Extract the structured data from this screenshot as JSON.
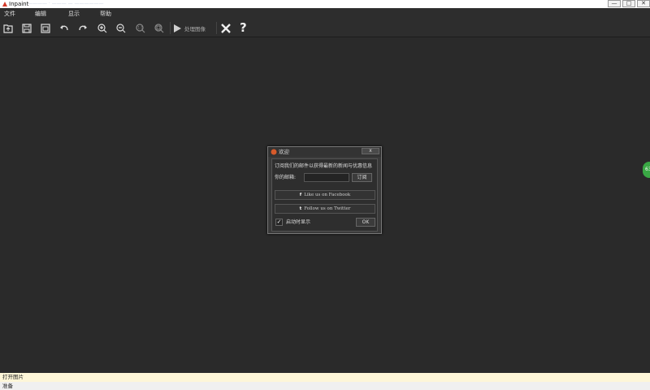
{
  "titlebar": {
    "app_name": "Inpaint",
    "ghost_text": "———— · ——— — ——————",
    "minimize": "—",
    "maximize": "□",
    "close": "✕"
  },
  "menu": {
    "file": "文件",
    "edit": "编辑",
    "view": "显示",
    "help": "帮助"
  },
  "toolbar": {
    "process_label": "处理图像",
    "help_symbol": "?",
    "icons": [
      "open-icon",
      "save-icon",
      "save-as-icon",
      "undo-icon",
      "redo-icon",
      "zoom-in-icon",
      "zoom-out-icon",
      "zoom-actual-icon",
      "zoom-fit-icon",
      "play-icon",
      "close-x-icon",
      "help-icon"
    ]
  },
  "side_widget": {
    "text": "63"
  },
  "dialog": {
    "title": "欢迎",
    "close": "x",
    "subscribe_text": "订阅我们的邮件以获得最新的新闻与优惠信息",
    "email_label": "你的邮箱:",
    "email_value": "",
    "subscribe_button": "订阅",
    "facebook_label": "Like us on Facebook",
    "facebook_icon": "f",
    "twitter_label": "Follow us on Twitter",
    "twitter_icon": "t",
    "show_on_startup_label": "启动时显示",
    "show_on_startup_checked": "✓",
    "ok_button": "OK"
  },
  "hint_bar": {
    "text": "打开图片"
  },
  "status_bar": {
    "text": "准备"
  },
  "colors": {
    "background": "#2a2a2a",
    "toolbar": "#2d2d2d",
    "hint": "#fdf6d8",
    "accent_green": "#3aa845"
  }
}
